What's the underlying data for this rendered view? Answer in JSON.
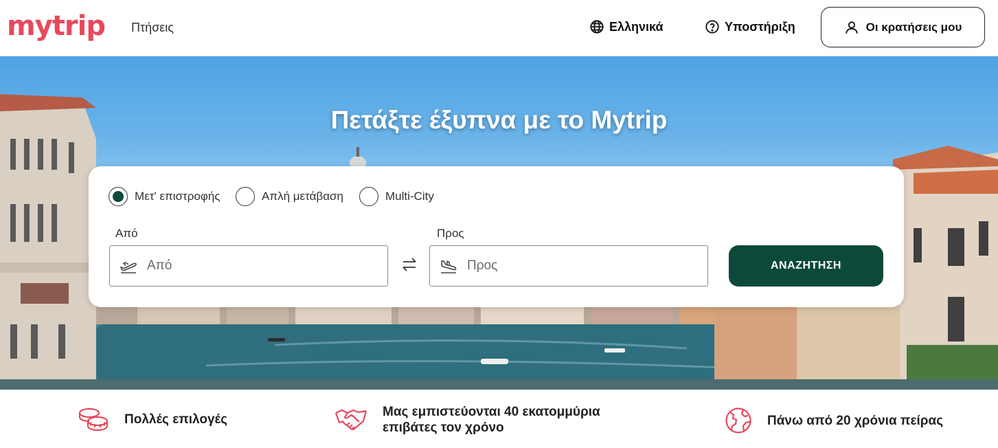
{
  "header": {
    "logo": "mytrip",
    "nav_flights": "Πτήσεις",
    "language": "Ελληνικά",
    "support": "Υποστήριξη",
    "my_bookings": "Οι κρατήσεις μου"
  },
  "hero": {
    "title": "Πετάξτε έξυπνα με το Mytrip"
  },
  "search": {
    "trip_types": [
      {
        "label": "Μετ' επιστροφής",
        "selected": true
      },
      {
        "label": "Απλή μετάβαση",
        "selected": false
      },
      {
        "label": "Multi-City",
        "selected": false
      }
    ],
    "from_label": "Από",
    "from_placeholder": "Από",
    "to_label": "Προς",
    "to_placeholder": "Προς",
    "button": "ΑΝΑΖΗΤΗΣΗ"
  },
  "features": [
    {
      "icon": "coins-icon",
      "line1": "Πολλές επιλογές",
      "line2": ""
    },
    {
      "icon": "handshake-icon",
      "line1": "Μας εμπιστεύονται 40 εκατομμύρια",
      "line2": "επιβάτες τον χρόνο"
    },
    {
      "icon": "globe-icon",
      "line1": "Πάνω από 20 χρόνια πείρας",
      "line2": ""
    }
  ],
  "colors": {
    "brand": "#e8495c",
    "primary_button": "#0b4a3a"
  }
}
